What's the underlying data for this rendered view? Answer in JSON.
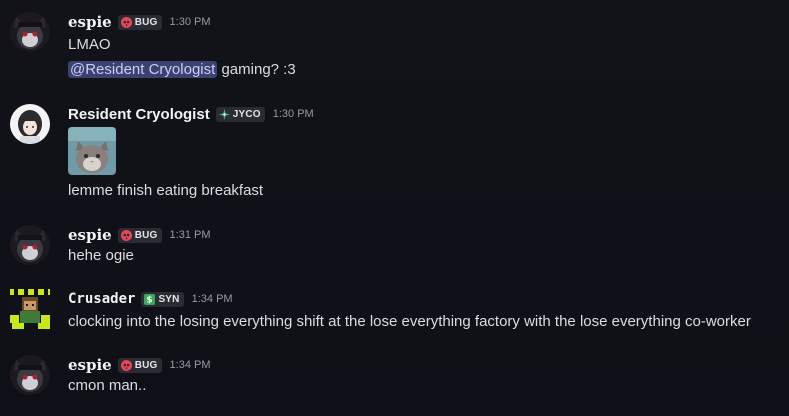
{
  "messages": [
    {
      "username": "espie",
      "tag": "BUG",
      "time": "1:30 PM",
      "lines": [
        "LMAO"
      ],
      "mention": "@Resident Cryologist",
      "mention_suffix": "gaming? :3"
    },
    {
      "username": "Resident Cryologist",
      "tag": "JYCO",
      "time": "1:30 PM",
      "attachment_icon": "cat-photo",
      "lines": [
        "lemme finish eating breakfast"
      ]
    },
    {
      "username": "espie",
      "tag": "BUG",
      "time": "1:31 PM",
      "lines": [
        "hehe ogie"
      ]
    },
    {
      "username": "Crusader",
      "tag": "SYN",
      "time": "1:34 PM",
      "lines": [
        "clocking into the losing everything shift at the lose everything factory with the lose everything co-worker"
      ]
    },
    {
      "username": "espie",
      "tag": "BUG",
      "time": "1:34 PM",
      "lines": [
        "cmon man.."
      ]
    }
  ],
  "colors": {
    "background": "#111119",
    "username": "#f2f3f5",
    "text": "#dbdee1",
    "timestamp": "#949ba4",
    "mention_bg": "#3c4270",
    "mention_text": "#c9cdfb",
    "tag_bg": "#2a2b33"
  }
}
